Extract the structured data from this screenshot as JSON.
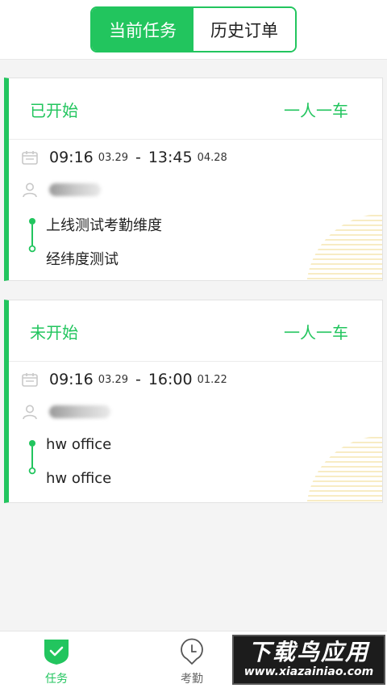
{
  "header": {
    "tabs": [
      {
        "label": "当前任务",
        "active": true
      },
      {
        "label": "历史订单",
        "active": false
      }
    ]
  },
  "orders": [
    {
      "status": "已开始",
      "mode": "一人一车",
      "start_time": "09:16",
      "start_date": "03.29",
      "end_time": "13:45",
      "end_date": "04.28",
      "origin": "上线测试考勤维度",
      "destination": "经纬度测试"
    },
    {
      "status": "未开始",
      "mode": "一人一车",
      "start_time": "09:16",
      "start_date": "03.29",
      "end_time": "16:00",
      "end_date": "01.22",
      "origin": "hw office",
      "destination": "hw office"
    }
  ],
  "tabbar": {
    "items": [
      {
        "label": "任务",
        "icon": "shield-check-icon",
        "active": true
      },
      {
        "label": "考勤",
        "icon": "clock-pin-icon",
        "active": false
      }
    ]
  },
  "watermark": {
    "title": "下载鸟应用",
    "url": "www.xiazainiao.com"
  },
  "colors": {
    "accent": "#22c55e",
    "stripe": "#f5e6b0",
    "text": "#222222"
  }
}
